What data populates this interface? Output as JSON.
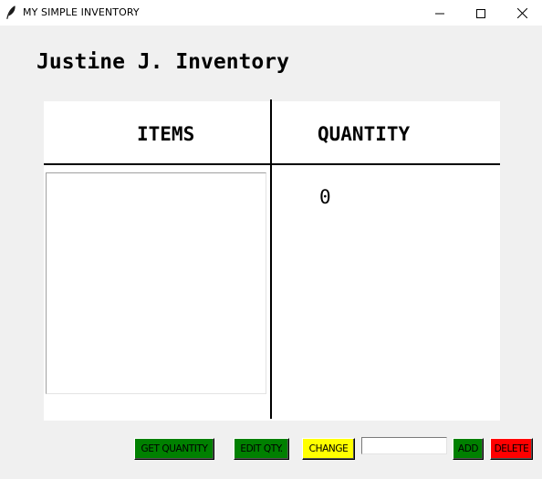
{
  "window": {
    "title": "MY SIMPLE INVENTORY",
    "icons": {
      "app": "feather-icon",
      "minimize": "minimize-icon",
      "maximize": "maximize-icon",
      "close": "close-icon"
    }
  },
  "heading": "Justine J. Inventory",
  "table": {
    "headers": {
      "items": "ITEMS",
      "quantity": "QUANTITY"
    },
    "items": [],
    "quantity_value": "0"
  },
  "controls": {
    "get_quantity": {
      "label": "GET QUANTITY",
      "color": "#008000",
      "text_color": "#000000"
    },
    "edit_qty": {
      "label": "EDIT QTY.",
      "color": "#008000",
      "text_color": "#000000"
    },
    "change": {
      "label": "CHANGE",
      "color": "#ffff00",
      "text_color": "#000000"
    },
    "entry": {
      "value": "",
      "placeholder": ""
    },
    "add": {
      "label": "ADD",
      "color": "#008000",
      "text_color": "#000000"
    },
    "delete": {
      "label": "DELETE",
      "color": "#ff0000",
      "text_color": "#000000"
    }
  }
}
